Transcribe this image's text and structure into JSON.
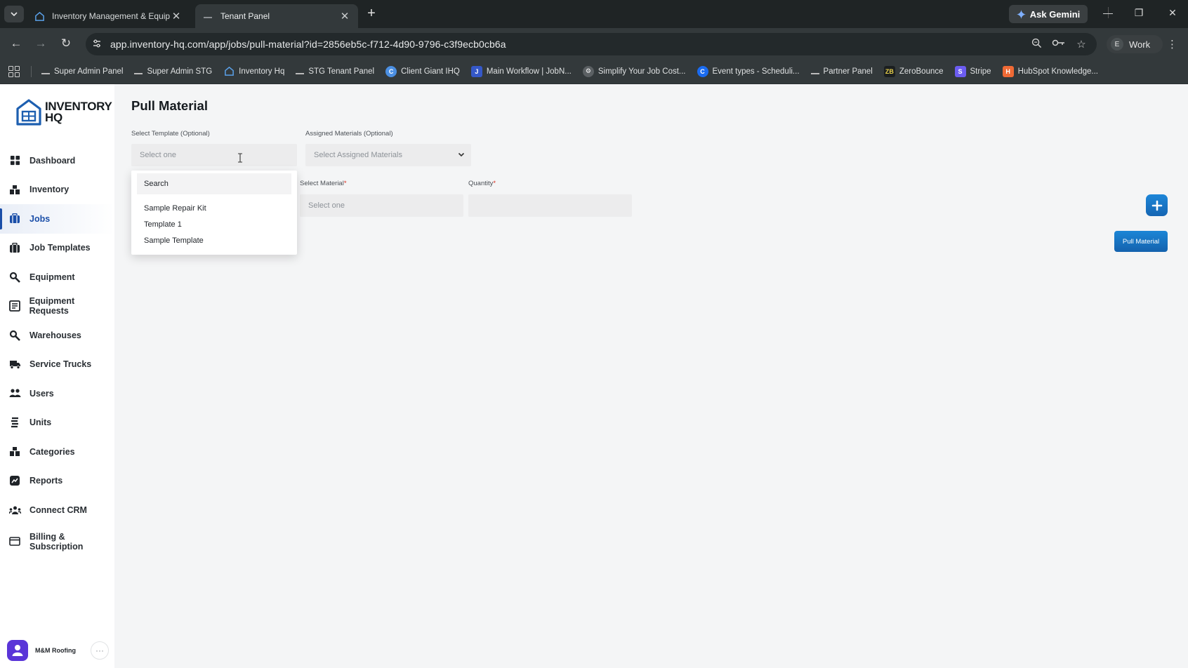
{
  "browser": {
    "tabs": [
      {
        "title": "Inventory Management & Equipm",
        "active": false
      },
      {
        "title": "Tenant Panel",
        "active": true
      }
    ],
    "ask_gemini": "Ask Gemini",
    "url": "app.inventory-hq.com/app/jobs/pull-material?id=2856eb5c-f712-4d90-9796-c3f9ecb0cb6a",
    "profile_initial": "E",
    "profile_label": "Work",
    "bookmarks": [
      {
        "label": "Super Admin Panel",
        "icon": "dash"
      },
      {
        "label": "Super Admin STG",
        "icon": "dash"
      },
      {
        "label": "Inventory Hq",
        "icon": "house"
      },
      {
        "label": "STG Tenant Panel",
        "icon": "dash"
      },
      {
        "label": "Client Giant IHQ",
        "icon": "circle"
      },
      {
        "label": "Main Workflow | JobN...",
        "icon": "jn"
      },
      {
        "label": "Simplify Your Job Cost...",
        "icon": "gear"
      },
      {
        "label": "Event types - Scheduli...",
        "icon": "calendly"
      },
      {
        "label": "Partner Panel",
        "icon": "dash"
      },
      {
        "label": "ZeroBounce",
        "icon": "zb"
      },
      {
        "label": "Stripe",
        "icon": "stripe"
      },
      {
        "label": "HubSpot Knowledge...",
        "icon": "hubspot"
      }
    ],
    "colors": {
      "chrome_dark": "#1f2425",
      "chrome_mid": "#33393b"
    }
  },
  "sidebar": {
    "logo_line1": "INVENTORY",
    "logo_line2": "HQ",
    "items": [
      {
        "label": "Dashboard",
        "icon": "dashboard-icon"
      },
      {
        "label": "Inventory",
        "icon": "inventory-icon"
      },
      {
        "label": "Jobs",
        "icon": "jobs-icon",
        "active": true
      },
      {
        "label": "Job Templates",
        "icon": "job-templates-icon"
      },
      {
        "label": "Equipment",
        "icon": "equipment-icon"
      },
      {
        "label": "Equipment Requests",
        "icon": "equipment-requests-icon"
      },
      {
        "label": "Warehouses",
        "icon": "warehouses-icon"
      },
      {
        "label": "Service Trucks",
        "icon": "truck-icon"
      },
      {
        "label": "Users",
        "icon": "users-icon"
      },
      {
        "label": "Units",
        "icon": "units-icon"
      },
      {
        "label": "Categories",
        "icon": "categories-icon"
      },
      {
        "label": "Reports",
        "icon": "reports-icon"
      },
      {
        "label": "Connect CRM",
        "icon": "crm-icon"
      },
      {
        "label": "Billing &",
        "label2": "Subscription",
        "icon": "billing-icon"
      }
    ],
    "user": {
      "name": "M&M Roofing",
      "more": "···"
    }
  },
  "main": {
    "title": "Pull Material",
    "template_label": "Select Template (Optional)",
    "template_placeholder": "Select one",
    "assigned_label": "Assigned Materials (Optional)",
    "assigned_placeholder": "Select Assigned Materials",
    "material_label": "Select Material",
    "material_placeholder": "Select one",
    "quantity_label": "Quantity",
    "required_mark": "*",
    "pull_button": "Pull Material",
    "dropdown": {
      "search_placeholder": "Search",
      "options": [
        "Sample Repair Kit",
        "Template 1",
        "Sample Template"
      ]
    },
    "colors": {
      "accent": "#1a73c8",
      "active_nav": "#1a4ea8"
    }
  }
}
